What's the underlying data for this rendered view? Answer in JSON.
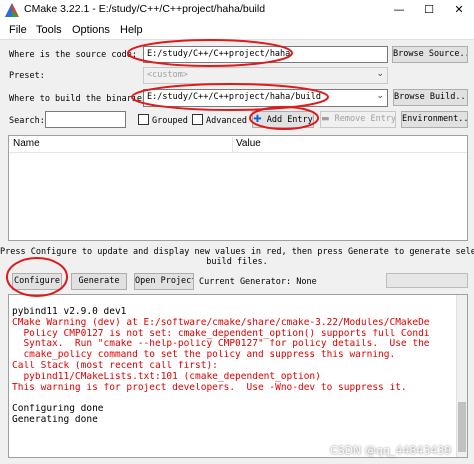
{
  "window": {
    "title": "CMake 3.22.1 - E:/study/C++/C++project/haha/build",
    "minimize": "—",
    "maximize": "☐",
    "close": "✕"
  },
  "menu": [
    "File",
    "Tools",
    "Options",
    "Help"
  ],
  "source": {
    "label": "Where is the source code:",
    "value": "E:/study/C++/C++project/haha",
    "browse": "Browse Source..."
  },
  "preset": {
    "label": "Preset:",
    "value": "<custom>"
  },
  "build": {
    "label": "Where to build the binaries:",
    "value": "E:/study/C++/C++project/haha/build",
    "browse": "Browse Build..."
  },
  "search": {
    "label": "Search:",
    "value": ""
  },
  "options": {
    "grouped": "Grouped",
    "advanced": "Advanced",
    "add_entry": "Add Entry",
    "remove_entry": "Remove Entry",
    "environment": "Environment..."
  },
  "table": {
    "col_name": "Name",
    "col_value": "Value"
  },
  "notice": {
    "line1": "Press Configure to update and display new values in red, then press Generate to generate selected",
    "line2": "build files."
  },
  "actions": {
    "configure": "Configure",
    "generate": "Generate",
    "open_project": "Open Project",
    "generator_label": "Current Generator: None"
  },
  "output": [
    {
      "text": "pybind11 v2.9.0 dev1",
      "color": "black"
    },
    {
      "text": "CMake Warning (dev) at E:/software/cmake/share/cmake-3.22/Modules/CMakeDe",
      "color": "red"
    },
    {
      "text": "  Policy CMP0127 is not set: cmake_dependent_option() supports full Condi",
      "color": "red"
    },
    {
      "text": "  Syntax.  Run \"cmake --help-policy CMP0127\" for policy details.  Use the",
      "color": "red"
    },
    {
      "text": "  cmake_policy command to set the policy and suppress this warning.",
      "color": "red"
    },
    {
      "text": "Call Stack (most recent call first):",
      "color": "red"
    },
    {
      "text": "  pybind11/CMakeLists.txt:101 (cmake_dependent_option)",
      "color": "red"
    },
    {
      "text": "This warning is for project developers.  Use -Wno-dev to suppress it.",
      "color": "red"
    },
    {
      "text": "",
      "color": "black"
    },
    {
      "text": "Configuring done",
      "color": "black"
    },
    {
      "text": "Generating done",
      "color": "black"
    }
  ],
  "watermark": "CSDN @qq_44843439",
  "colors": {
    "annotation": "#e0191b",
    "error_text": "#e00000",
    "add_icon": "#1a5fd1"
  }
}
